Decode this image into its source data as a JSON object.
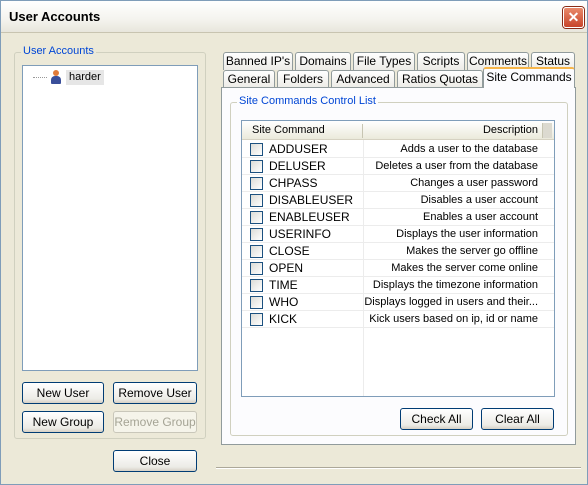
{
  "window": {
    "title": "User Accounts"
  },
  "left": {
    "group_label": "User Accounts",
    "tree_items": [
      "harder"
    ],
    "new_user": "New User",
    "remove_user": "Remove User",
    "new_group": "New Group",
    "remove_group": "Remove Group",
    "close": "Close"
  },
  "tabs": {
    "row1": [
      "Banned IP's",
      "Domains",
      "File Types",
      "Scripts",
      "Comments",
      "Status"
    ],
    "row2": [
      "General",
      "Folders",
      "Advanced",
      "Ratios  Quotas",
      "Site Commands"
    ],
    "active": "Site Commands"
  },
  "site_commands": {
    "group_label": "Site Commands Control List",
    "columns": [
      "Site Command",
      "Description"
    ],
    "rows": [
      {
        "command": "ADDUSER",
        "description": "Adds a user to the database",
        "checked": false
      },
      {
        "command": "DELUSER",
        "description": "Deletes a user from the database",
        "checked": false
      },
      {
        "command": "CHPASS",
        "description": "Changes a user password",
        "checked": false
      },
      {
        "command": "DISABLEUSER",
        "description": "Disables a user account",
        "checked": false
      },
      {
        "command": "ENABLEUSER",
        "description": "Enables a user account",
        "checked": false
      },
      {
        "command": "USERINFO",
        "description": "Displays the user information",
        "checked": false
      },
      {
        "command": "CLOSE",
        "description": "Makes the server go offline",
        "checked": false
      },
      {
        "command": "OPEN",
        "description": "Makes the server come online",
        "checked": false
      },
      {
        "command": "TIME",
        "description": "Displays the timezone information",
        "checked": false
      },
      {
        "command": "WHO",
        "description": "Displays logged in users and their...",
        "checked": false
      },
      {
        "command": "KICK",
        "description": "Kick users based on ip, id or name",
        "checked": false
      }
    ],
    "check_all": "Check All",
    "clear_all": "Clear All"
  },
  "colors": {
    "accent": "#0046d5",
    "active_tab": "#f7b64a",
    "close_button": "#c8442a"
  }
}
